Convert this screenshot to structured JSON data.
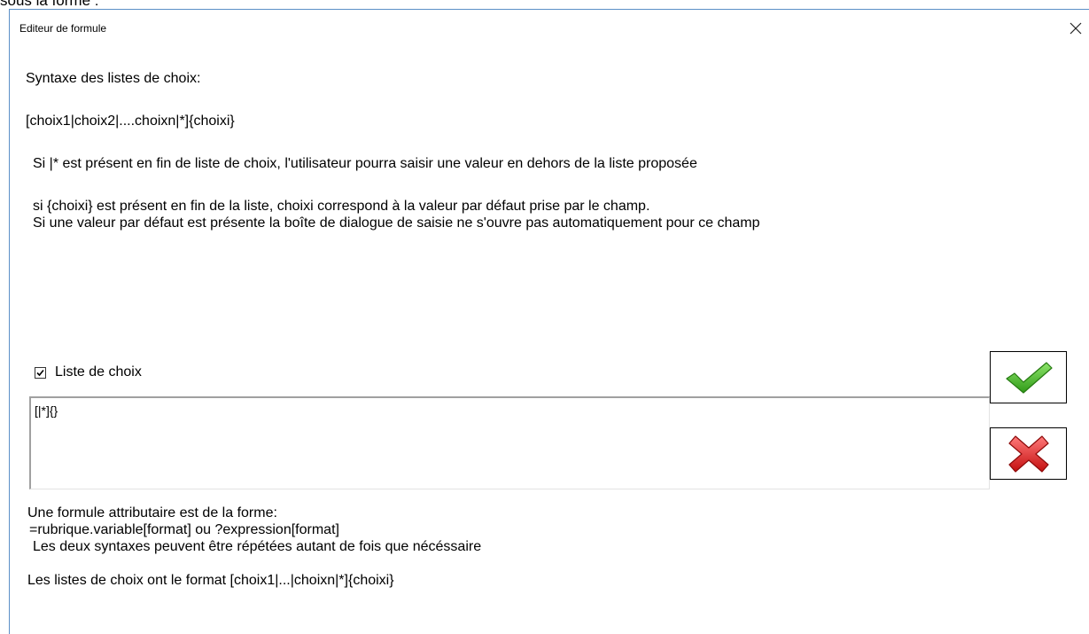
{
  "above_window_text": "sous la forme :",
  "window": {
    "title": "Editeur de formule"
  },
  "help": {
    "heading": "Syntaxe des listes de choix:",
    "syntax": "[choix1|choix2|....choixn|*]{choixi}",
    "note1": "Si |* est présent en fin de liste de choix, l'utilisateur pourra saisir une valeur en dehors de la liste proposée",
    "note2_line1": "si {choixi} est présent en fin de la liste, choixi correspond à la valeur par défaut prise par le champ.",
    "note2_line2": "Si une valeur par défaut est présente la boîte de dialogue de saisie ne s'ouvre pas automatiquement pour ce champ"
  },
  "checkbox": {
    "label": "Liste de choix",
    "checked": true
  },
  "formula_input": {
    "value": "[|*]{}"
  },
  "buttons": {
    "ok_icon": "checkmark-icon",
    "cancel_icon": "red-x-icon"
  },
  "footer": {
    "line1": "Une formule attributaire est de la forme:",
    "line2": "=rubrique.variable[format] ou ?expression[format]",
    "line3": "Les deux syntaxes peuvent être répétées autant de fois que nécéssaire",
    "line4": "Les listes de choix ont le format [choix1|...|choixn|*]{choixi}"
  },
  "colors": {
    "window_border": "#5b8fc7",
    "ok_green": "#3cb521",
    "cancel_red": "#e01818"
  }
}
